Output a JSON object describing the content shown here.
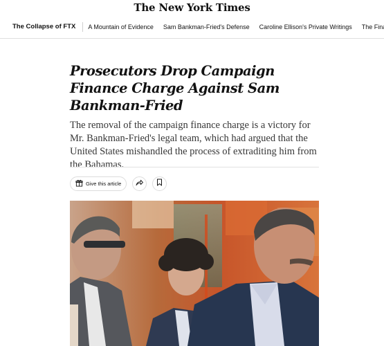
{
  "masthead": {
    "logo_text": "The New York Times"
  },
  "section_nav": {
    "title": "The Collapse of FTX",
    "items": [
      "A Mountain of Evidence",
      "Sam Bankman-Fried's Defense",
      "Caroline Ellison's Private Writings",
      "The Final Days of FTX"
    ]
  },
  "article": {
    "headline": "Prosecutors Drop Campaign Finance Charge Against Sam Bankman-Fried",
    "summary": "The removal of the campaign finance charge is a victory for Mr. Bankman-Fried's legal team, which had argued that the United States mishandled the process of extraditing him from the Bahamas."
  },
  "share_tools": {
    "gift_label": "Give this article",
    "gift_icon": "gift-icon",
    "share_icon": "share-arrow-icon",
    "save_icon": "bookmark-icon"
  },
  "colors": {
    "text": "#121212",
    "summary_text": "#363636",
    "divider": "#e2e2e2"
  }
}
